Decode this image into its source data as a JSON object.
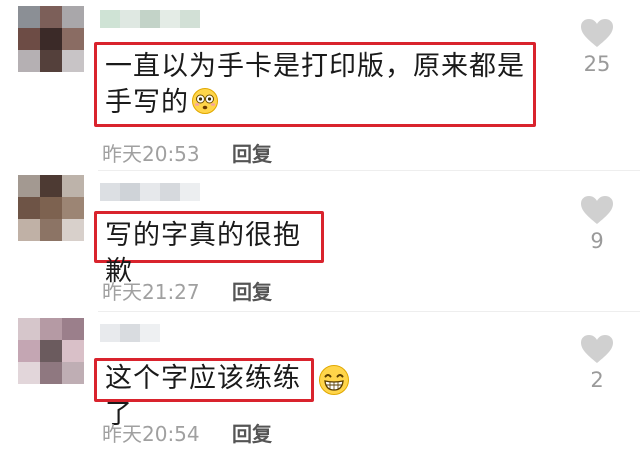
{
  "comments": [
    {
      "text": "一直以为手卡是打印版，原来都是手写的",
      "time": "昨天20:53",
      "reply_label": "回复",
      "likes": "25",
      "emoji": "flushed-face-icon"
    },
    {
      "text": "写的字真的很抱歉",
      "time": "昨天21:27",
      "reply_label": "回复",
      "likes": "9"
    },
    {
      "text": "这个字应该练练了",
      "time": "昨天20:54",
      "reply_label": "回复",
      "likes": "2",
      "emoji": "grinning-face-icon"
    }
  ],
  "colors": {
    "highlight_border": "#d9232d",
    "like_heart": "#d0d0d0",
    "meta_text": "#a0a0a0"
  }
}
